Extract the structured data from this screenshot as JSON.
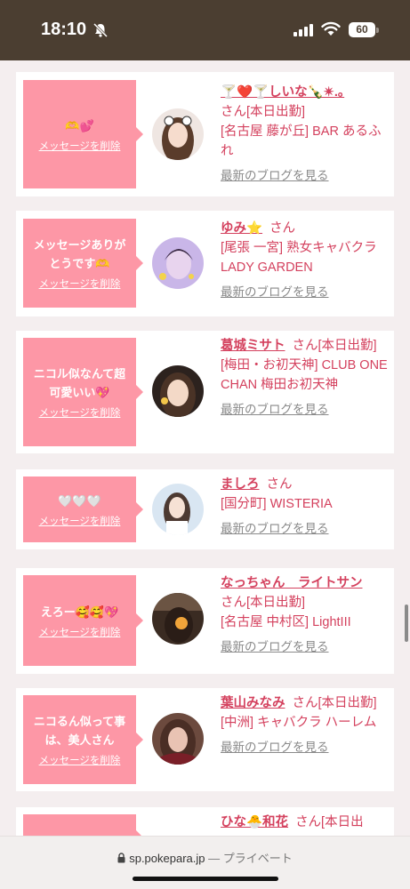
{
  "status": {
    "time": "18:10",
    "battery": "60"
  },
  "browser": {
    "url": "sp.pokepara.jp",
    "separator": "—",
    "mode": "プライベート"
  },
  "cards": [
    {
      "message": "🫶💕",
      "delete_label": "メッセージを削除",
      "name": "🍸❤️🍸しいな🍾✴︎.｡",
      "suffix": "さん[本日出勤]",
      "shop": "[名古屋 藤が丘] BAR あるふれ",
      "blog_label": "最新のブログを見る"
    },
    {
      "message": "メッセージありがとうです🫶",
      "delete_label": "メッセージを削除",
      "name": "ゆみ⭐",
      "suffix": "さん",
      "shop": "[尾張 一宮] 熟女キャバクラ LADY GARDEN",
      "blog_label": "最新のブログを見る"
    },
    {
      "message": "ニコル似なんて超可愛いい💖",
      "delete_label": "メッセージを削除",
      "name": "葛城ミサト",
      "suffix": "さん[本日出勤]",
      "shop": "[梅田・お初天神] CLUB ONE CHAN 梅田お初天神",
      "blog_label": "最新のブログを見る"
    },
    {
      "message": "🤍🤍🤍",
      "delete_label": "メッセージを削除",
      "name": "ましろ",
      "suffix": "さん",
      "shop": "[国分町] WISTERIA",
      "blog_label": "最新のブログを見る"
    },
    {
      "message": "えろー🥰🥰💖",
      "delete_label": "メッセージを削除",
      "name": "なっちゃん　ライトサン",
      "suffix": "さん[本日出勤]",
      "shop": "[名古屋 中村区] LightIII",
      "blog_label": "最新のブログを見る"
    },
    {
      "message": "ニコるん似って事は、美人さん",
      "delete_label": "メッセージを削除",
      "name": "葉山みなみ",
      "suffix": "さん[本日出勤]",
      "shop": "[中洲] キャバクラ ハーレム",
      "blog_label": "最新のブログを見る"
    },
    {
      "message": "",
      "delete_label": "",
      "name": "ひな🐣和花",
      "suffix": "さん[本日出",
      "shop": "",
      "blog_label": ""
    }
  ],
  "colors": {
    "status_bar": "#4b3e31",
    "bubble": "#fd97a6",
    "link": "#d4415e",
    "muted": "#8a8a8a"
  }
}
